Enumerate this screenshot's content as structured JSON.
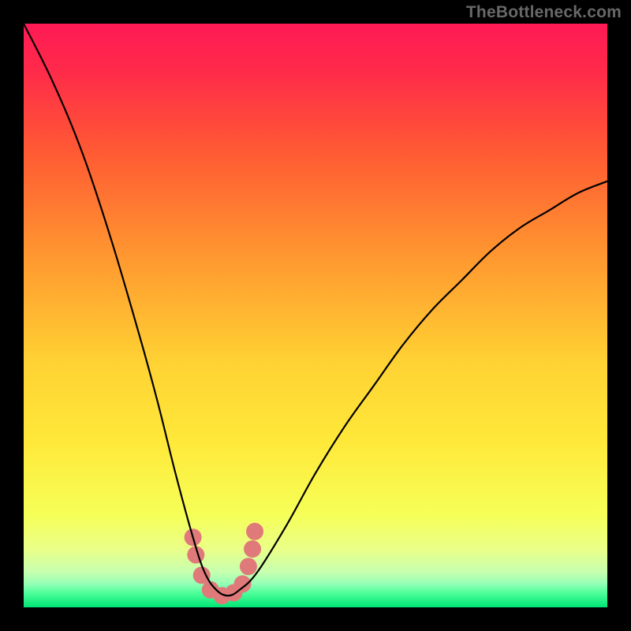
{
  "attribution": "TheBottleneck.com",
  "chart_data": {
    "type": "line",
    "title": "",
    "xlabel": "",
    "ylabel": "",
    "xlim": [
      0,
      100
    ],
    "ylim": [
      0,
      100
    ],
    "grid": false,
    "legend": false,
    "series": [
      {
        "name": "bottleneck-curve",
        "x": [
          0,
          5,
          10,
          15,
          20,
          23,
          26,
          29,
          31,
          33,
          35,
          37,
          40,
          45,
          50,
          55,
          60,
          65,
          70,
          75,
          80,
          85,
          90,
          95,
          100
        ],
        "values": [
          100,
          90,
          78,
          63,
          46,
          35,
          23,
          12,
          6,
          3,
          2,
          3,
          6,
          14,
          23,
          31,
          38,
          45,
          51,
          56,
          61,
          65,
          68,
          71,
          73
        ]
      },
      {
        "name": "dots",
        "x": [
          29,
          29.5,
          30.5,
          32,
          34,
          36,
          37.5,
          38.5,
          39.2,
          39.6
        ],
        "values": [
          12,
          9,
          5.5,
          3,
          2,
          2.5,
          4,
          7,
          10,
          13
        ]
      }
    ],
    "gradient_stops": [
      {
        "pct": 0,
        "color": "#ff1a55"
      },
      {
        "pct": 8,
        "color": "#ff2a4a"
      },
      {
        "pct": 22,
        "color": "#ff5a33"
      },
      {
        "pct": 40,
        "color": "#ff9830"
      },
      {
        "pct": 58,
        "color": "#ffd233"
      },
      {
        "pct": 72,
        "color": "#ffe93a"
      },
      {
        "pct": 84,
        "color": "#f6ff57"
      },
      {
        "pct": 90,
        "color": "#eaff88"
      },
      {
        "pct": 94,
        "color": "#c6ffb0"
      },
      {
        "pct": 96,
        "color": "#93ffb6"
      },
      {
        "pct": 97.5,
        "color": "#4fff9a"
      },
      {
        "pct": 100,
        "color": "#00e676"
      }
    ],
    "curve_color": "#000000",
    "dot_color": "#e07a7a",
    "dot_radius": 11
  }
}
